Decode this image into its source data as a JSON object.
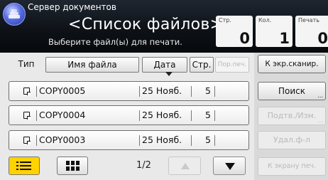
{
  "header": {
    "app_title": "Сервер документов",
    "screen_title": "<Список файлов>",
    "subtitle": "Выберите файл(ы) для печати.",
    "counters": [
      {
        "label": "Стр.",
        "value": "0"
      },
      {
        "label": "Кол.",
        "value": "1"
      },
      {
        "label": "Печать",
        "value": "0"
      }
    ]
  },
  "columns": {
    "type": "Тип",
    "name": "Имя файла",
    "date": "Дата",
    "pages": "Стр.",
    "pages_disabled": "Пор.печ."
  },
  "rows": [
    {
      "name": "COPY0005",
      "date": "25 Нояб.",
      "pages": "5"
    },
    {
      "name": "COPY0004",
      "date": "25 Нояб.",
      "pages": "5"
    },
    {
      "name": "COPY0003",
      "date": "25 Нояб.",
      "pages": "5"
    }
  ],
  "pager": {
    "indicator": "1/2"
  },
  "side": {
    "to_scanner": "К экр.сканир.",
    "search": "Поиск",
    "confirm_edit": "Подтв./Изм.",
    "delete": "Удал.ф-л",
    "to_print": "К экрану печ."
  },
  "colors": {
    "header_bg": "#0d1116",
    "selected_view": "#ffd200",
    "disabled_text": "#b9b9b9"
  }
}
